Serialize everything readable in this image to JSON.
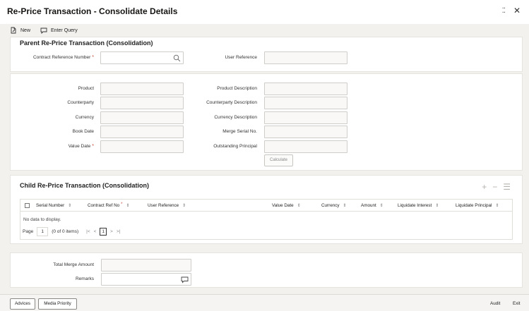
{
  "window": {
    "title": "Re-Price Transaction - Consolidate Details",
    "restore_glyph": "⁚⁚",
    "close_glyph": "✕"
  },
  "toolbar": {
    "new_label": "New",
    "enter_query_label": "Enter Query"
  },
  "parent": {
    "section_title": "Parent Re-Price Transaction (Consolidation)",
    "contract_ref_label": "Contract Reference Number",
    "contract_ref_value": "",
    "user_ref_label": "User Reference",
    "user_ref_value": ""
  },
  "details": {
    "product_label": "Product",
    "product_desc_label": "Product Description",
    "counterparty_label": "Counterparty",
    "counterparty_desc_label": "Counterparty Description",
    "currency_label": "Currency",
    "currency_desc_label": "Currency Description",
    "book_date_label": "Book Date",
    "merge_serial_label": "Merge Serial No.",
    "value_date_label": "Value Date",
    "outstanding_label": "Outstanding Principal",
    "calculate_label": "Calculate"
  },
  "child": {
    "section_title": "Child Re-Price Transaction (Consolidation)",
    "columns": [
      "Serial Number",
      "Contract Ref No",
      "User Reference",
      "Value Date",
      "Currency",
      "Amount",
      "Liquidate Interest",
      "Liquidate Principal"
    ],
    "no_data": "No data to display.",
    "pager": {
      "page_label": "Page",
      "page_value": "1",
      "items_text": "(0 of 0 items)",
      "first": "|<",
      "prev": "<",
      "current": "1",
      "next": ">",
      "last": ">|"
    }
  },
  "summary": {
    "total_merge_label": "Total Merge Amount",
    "remarks_label": "Remarks"
  },
  "footer": {
    "advices_label": "Advices",
    "media_priority_label": "Media Priority",
    "audit_label": "Audit",
    "exit_label": "Exit"
  },
  "colors": {
    "required": "#c74634",
    "background": "#f2f1ee"
  }
}
